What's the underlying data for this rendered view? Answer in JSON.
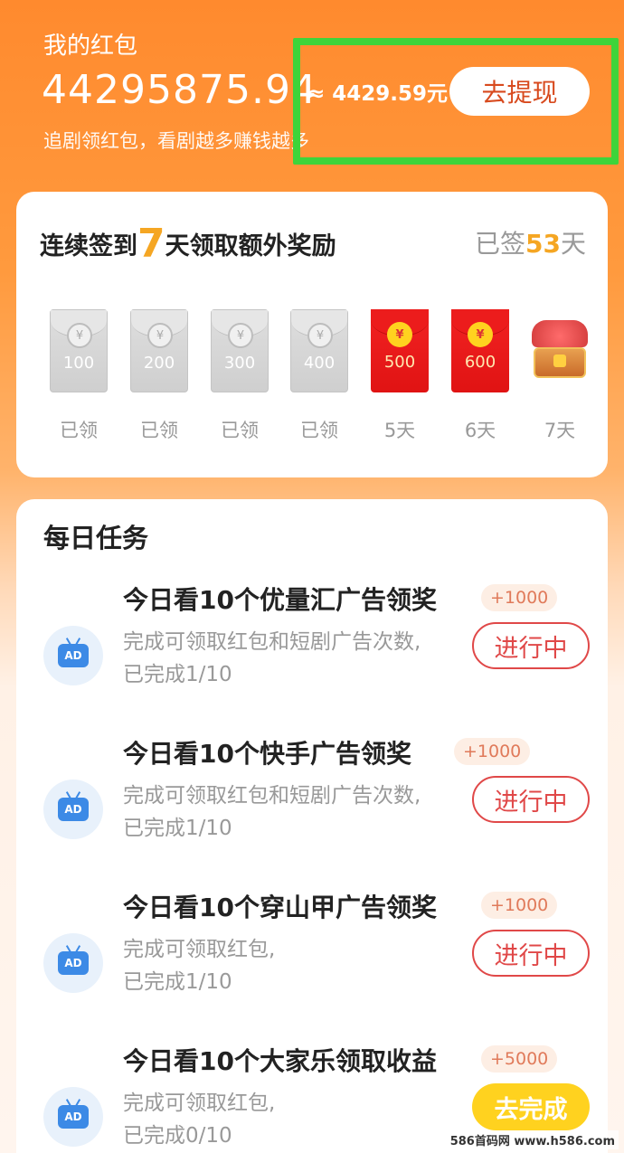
{
  "header": {
    "title": "我的红包",
    "balance": "44295875.94",
    "approx": "≈ 4429.59元",
    "withdraw_label": "去提现",
    "subtitle": "追剧领红包，看剧越多赚钱越多"
  },
  "signin": {
    "title_prefix": "连续签到",
    "title_days": "7",
    "title_suffix": "天领取额外奖励",
    "signed_prefix": "已签",
    "signed_days": "53",
    "signed_suffix": "天",
    "coin_symbol": "¥",
    "days": [
      {
        "amount": "100",
        "label": "已领",
        "state": "claimed"
      },
      {
        "amount": "200",
        "label": "已领",
        "state": "claimed"
      },
      {
        "amount": "300",
        "label": "已领",
        "state": "claimed"
      },
      {
        "amount": "400",
        "label": "已领",
        "state": "claimed"
      },
      {
        "amount": "500",
        "label": "5天",
        "state": "pending"
      },
      {
        "amount": "600",
        "label": "6天",
        "state": "pending"
      },
      {
        "amount": "",
        "label": "7天",
        "state": "chest"
      }
    ]
  },
  "tasks": {
    "title": "每日任务",
    "icon_text": "AD",
    "items": [
      {
        "name": "今日看10个优量汇广告领奖",
        "reward": "+1000",
        "desc1": "完成可领取红包和短剧广告次数,",
        "desc2": "已完成1/10",
        "button": "进行中"
      },
      {
        "name": "今日看10个快手广告领奖",
        "reward": "+1000",
        "desc1": "完成可领取红包和短剧广告次数,",
        "desc2": "已完成1/10",
        "button": "进行中"
      },
      {
        "name": "今日看10个穿山甲广告领奖",
        "reward": "+1000",
        "desc1": "完成可领取红包,",
        "desc2": "已完成1/10",
        "button": "进行中"
      },
      {
        "name": "今日看10个大家乐领取收益",
        "reward": "+5000",
        "desc1": "完成可领取红包,",
        "desc2": "已完成0/10",
        "button": "去完成"
      }
    ]
  },
  "watermark": "586首码网 www.h586.com",
  "colors": {
    "accent": "#ff8a2e",
    "gold": "#f5a623",
    "red": "#e04848",
    "highlight": "#3ed43a"
  }
}
